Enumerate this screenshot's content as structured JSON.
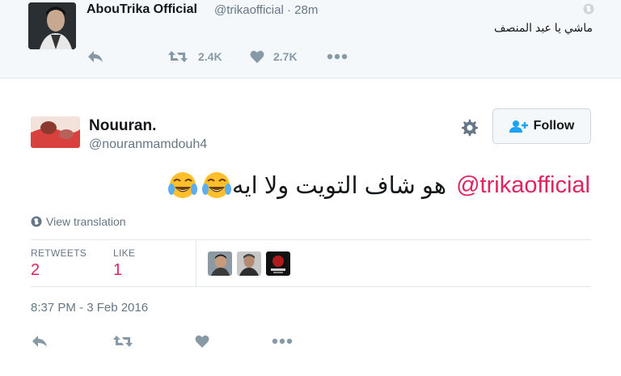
{
  "parent_tweet": {
    "display_name": "AbouTrika Official",
    "handle": "@trikaofficial",
    "time": "· 28m",
    "text": "ماشي يا عبد المنصف",
    "retweets": "2.4K",
    "likes": "2.7K",
    "icons": [
      "reply-icon",
      "retweet-icon",
      "heart-icon",
      "more-icon",
      "globe-icon"
    ]
  },
  "tweet": {
    "display_name": "Nouuran.",
    "handle": "@nouranmamdouh4",
    "follow_label": "Follow",
    "mention": "@trikaofficial",
    "text": "هو شاف التويت ولا ايه",
    "emoji": "face-with-tears-of-joy",
    "view_translation": "View translation",
    "retweets_label": "RETWEETS",
    "retweets_count": "2",
    "likes_label": "LIKE",
    "likes_count": "1",
    "timestamp": "8:37 PM - 3 Feb 2016"
  },
  "colors": {
    "accent": "#e0245e",
    "muted": "#657786",
    "icon": "#8899a6",
    "border": "#e1e8ed"
  }
}
